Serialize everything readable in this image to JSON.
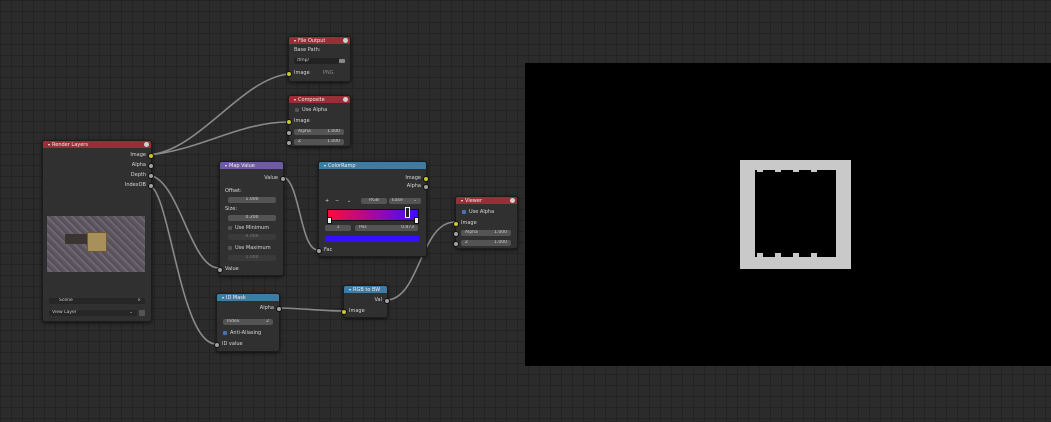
{
  "nodes": {
    "render_layers": {
      "title": "Render Layers",
      "outputs": [
        "Image",
        "Alpha",
        "Depth",
        "IndexOB"
      ],
      "scene_label": "Scene",
      "view_layer": "View Layer"
    },
    "file_output": {
      "title": "File Output",
      "base_path_label": "Base Path:",
      "path": "/tmp/",
      "input_label": "Image",
      "format": "PNG"
    },
    "composite": {
      "title": "Composite",
      "use_alpha": "Use Alpha",
      "input_image": "Image",
      "alpha_label": "Alpha",
      "alpha_value": "1.000",
      "z_label": "Z",
      "z_value": "1.000"
    },
    "map_value": {
      "title": "Map Value",
      "output": "Value",
      "offset_label": "Offset:",
      "offset_value": "1.000",
      "size_label": "Size:",
      "size_value": "0.200",
      "use_min": "Use Minimum",
      "min_value": "0.000",
      "use_max": "Use Maximum",
      "max_value": "1.000",
      "input": "Value"
    },
    "colorramp": {
      "title": "ColorRamp",
      "out_image": "Image",
      "out_alpha": "Alpha",
      "mode": "RGB",
      "interp": "Ease",
      "index": "1",
      "pos_label": "Pos",
      "pos_value": "0.873",
      "input": "Fac"
    },
    "viewer": {
      "title": "Viewer",
      "use_alpha": "Use Alpha",
      "input_image": "Image",
      "alpha_label": "Alpha",
      "alpha_value": "1.000",
      "z_label": "Z",
      "z_value": "1.000"
    },
    "id_mask": {
      "title": "ID Mask",
      "output": "Alpha",
      "index_label": "Index",
      "index_value": "2",
      "anti_alias": "Anti-Aliasing",
      "input": "ID value"
    },
    "rgb_to_bw": {
      "title": "RGB to BW",
      "output": "Val",
      "input": "Image"
    }
  },
  "colors": {
    "socket_image": "#c7c729",
    "socket_value": "#a1a1a1",
    "header_output": "#9a2d36",
    "header_converter": "#3e7ca4",
    "header_vector": "#6f5aa8",
    "ramp_start": "#ff0a3a",
    "ramp_end": "#3f0aff",
    "ramp_output_swatch": "#3510ff"
  }
}
